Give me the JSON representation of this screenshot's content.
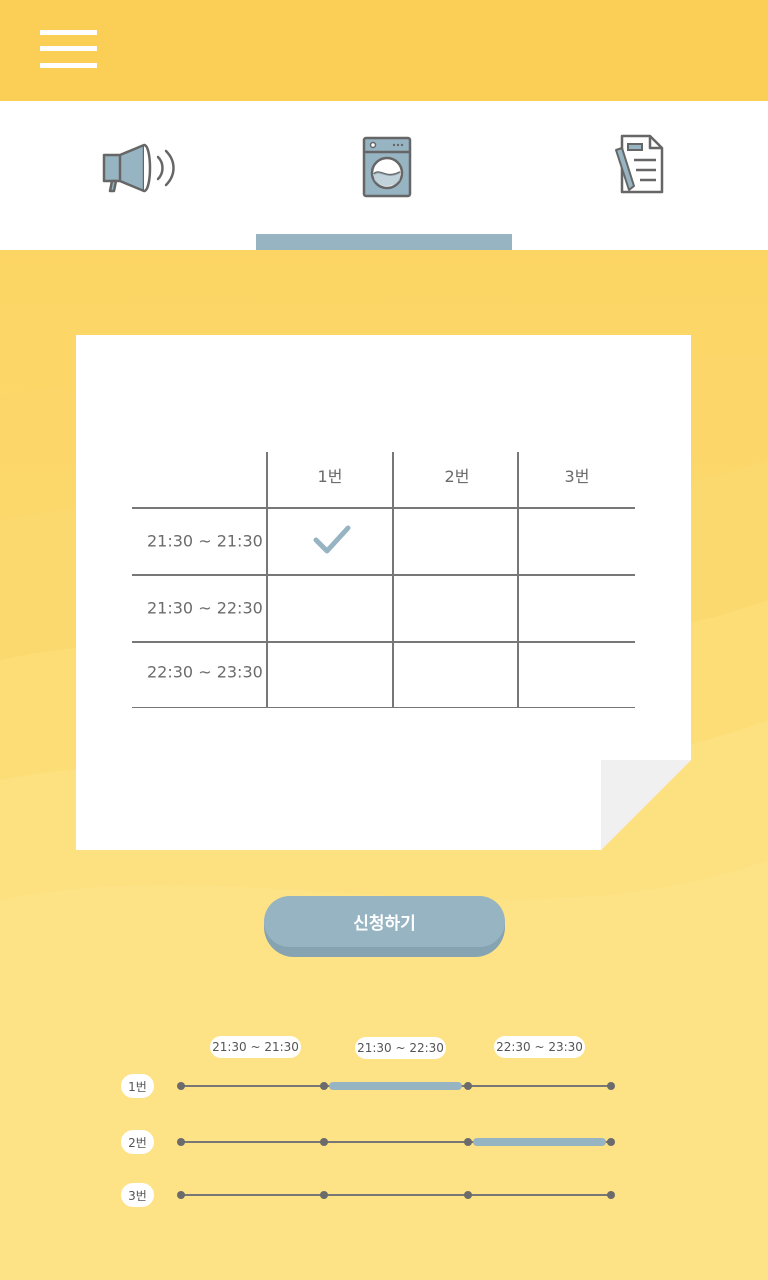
{
  "app": {
    "menu_icon": "hamburger-icon"
  },
  "tabs": [
    {
      "icon": "megaphone-icon",
      "label": ""
    },
    {
      "icon": "washing-machine-icon",
      "label": ""
    },
    {
      "icon": "document-pen-icon",
      "label": ""
    }
  ],
  "active_tab_index": 1,
  "colors": {
    "header": "#fbcf55",
    "accent": "#97b4c3",
    "background_top": "#fbd15a",
    "background_bottom": "#fde68a"
  },
  "table": {
    "columns": [
      "1번",
      "2번",
      "3번"
    ],
    "rows": [
      {
        "time": "21:30 ~ 21:30",
        "checked": [
          true,
          false,
          false
        ]
      },
      {
        "time": "21:30 ~ 22:30",
        "checked": [
          false,
          false,
          false
        ]
      },
      {
        "time": "22:30 ~ 23:30",
        "checked": [
          false,
          false,
          false
        ]
      }
    ]
  },
  "submit_label": "신청하기",
  "timeline": {
    "slots": [
      "21:30 ~ 21:30",
      "21:30 ~ 22:30",
      "22:30 ~ 23:30"
    ],
    "machines": [
      {
        "label": "1번",
        "booked_slots": [
          1
        ]
      },
      {
        "label": "2번",
        "booked_slots": [
          2
        ]
      },
      {
        "label": "3번",
        "booked_slots": []
      }
    ]
  }
}
